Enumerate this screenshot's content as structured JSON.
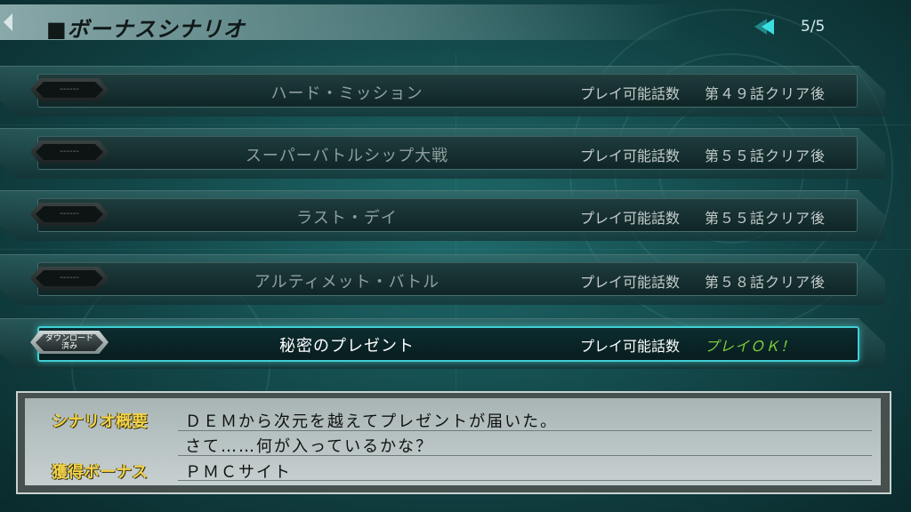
{
  "header": {
    "title": "■ボーナスシナリオ",
    "page": "5/5"
  },
  "scenarios": [
    {
      "tag": "------",
      "title": "ハード・ミッション",
      "cond_label": "プレイ可能話数",
      "cond_value": "第４９話クリア後",
      "selected": false
    },
    {
      "tag": "------",
      "title": "スーパーバトルシップ大戦",
      "cond_label": "プレイ可能話数",
      "cond_value": "第５５話クリア後",
      "selected": false
    },
    {
      "tag": "------",
      "title": "ラスト・デイ",
      "cond_label": "プレイ可能話数",
      "cond_value": "第５５話クリア後",
      "selected": false
    },
    {
      "tag": "------",
      "title": "アルティメット・バトル",
      "cond_label": "プレイ可能話数",
      "cond_value": "第５８話クリア後",
      "selected": false
    },
    {
      "tag": "ダウンロード\n済み",
      "title": "秘密のプレゼント",
      "cond_label": "プレイ可能話数",
      "cond_value": "プレイＯＫ！",
      "selected": true
    }
  ],
  "info": {
    "summary_label": "シナリオ概要",
    "summary_line1": "ＤＥＭから次元を越えてプレゼントが届いた。",
    "summary_line2": "さて……何が入っているかな？",
    "bonus_label": "獲得ボーナス",
    "bonus_value": "ＰＭＣサイト"
  },
  "colors": {
    "accent": "#3fd0d4",
    "ok_green": "#7fce3a",
    "label_yellow": "#f2d24a"
  },
  "icons": {
    "back": "back-notch-icon",
    "page_prev": "double-left-arrow-icon"
  }
}
